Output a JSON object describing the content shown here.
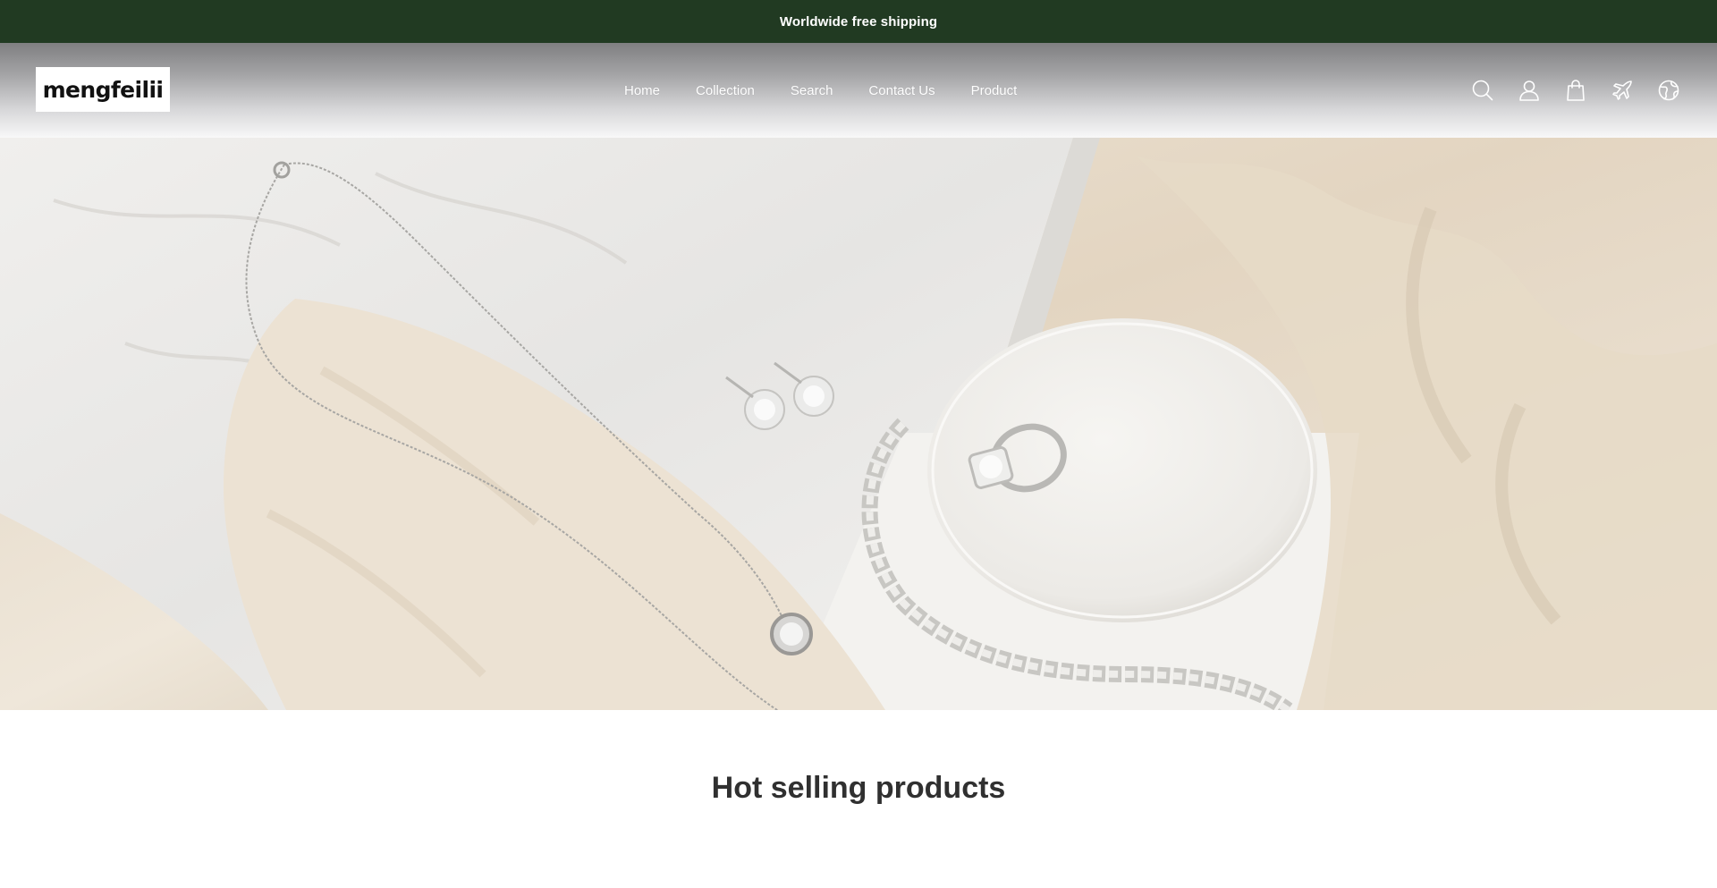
{
  "announcement": {
    "text": "Worldwide free shipping",
    "background": "#213a22"
  },
  "header": {
    "logo_text": "mengfeilii",
    "nav": [
      {
        "label": "Home"
      },
      {
        "label": "Collection"
      },
      {
        "label": "Search"
      },
      {
        "label": "Contact Us"
      },
      {
        "label": "Product"
      }
    ],
    "icons": [
      "search-icon",
      "account-icon",
      "cart-icon",
      "plane-icon",
      "globe-icon"
    ]
  },
  "hero": {
    "image": "silver jewelry on marble and cream silk"
  },
  "sections": {
    "hot_selling_title": "Hot selling products"
  }
}
